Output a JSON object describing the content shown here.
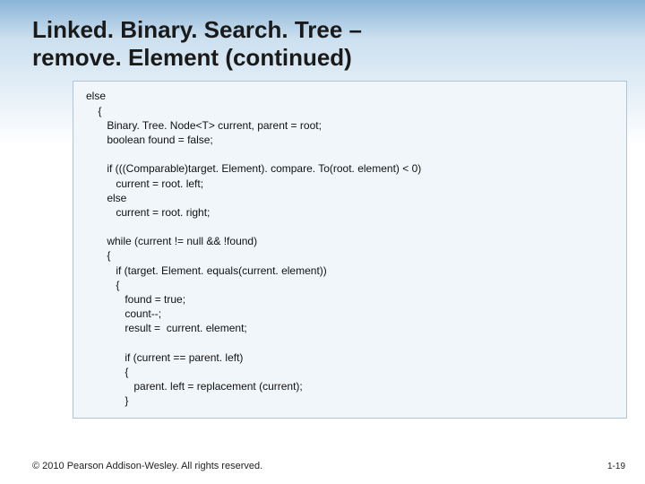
{
  "title_line1": "Linked. Binary. Search. Tree –",
  "title_line2": "remove. Element (continued)",
  "code": "else\n    {\n       Binary. Tree. Node<T> current, parent = root;\n       boolean found = false;\n\n       if (((Comparable)target. Element). compare. To(root. element) < 0)\n          current = root. left;\n       else\n          current = root. right;\n\n       while (current != null && !found)\n       {\n          if (target. Element. equals(current. element))\n          {\n             found = true;\n             count--;\n             result =  current. element;\n\n             if (current == parent. left)\n             {\n                parent. left = replacement (current);\n             }",
  "footer": "© 2010 Pearson Addison-Wesley. All rights reserved.",
  "pagenum": "1-19"
}
